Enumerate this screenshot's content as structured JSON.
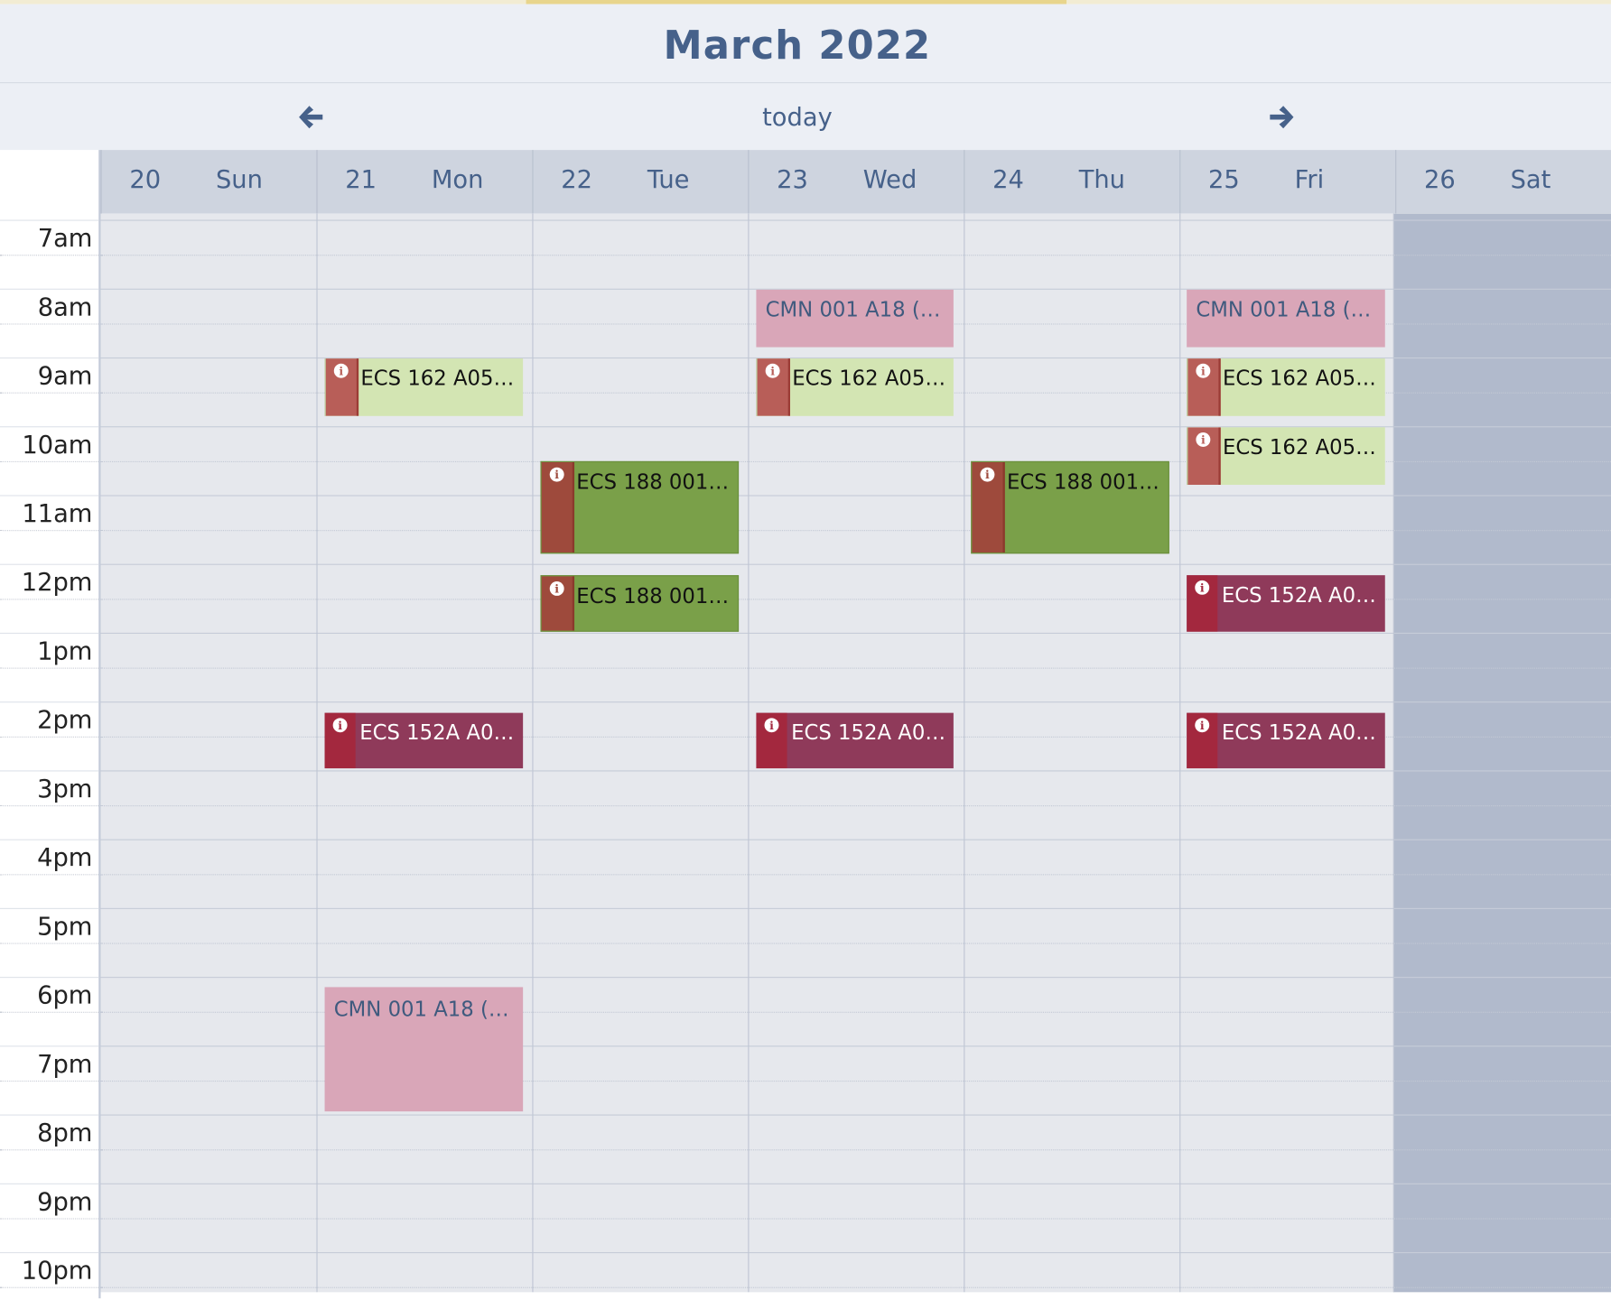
{
  "calendar": {
    "month_title": "March 2022",
    "today_label": "today",
    "prev_icon": "arrow-left-icon",
    "next_icon": "arrow-right-icon",
    "days": [
      {
        "num": "20",
        "name": "Sun"
      },
      {
        "num": "21",
        "name": "Mon"
      },
      {
        "num": "22",
        "name": "Tue"
      },
      {
        "num": "23",
        "name": "Wed"
      },
      {
        "num": "24",
        "name": "Thu"
      },
      {
        "num": "25",
        "name": "Fri"
      },
      {
        "num": "26",
        "name": "Sat"
      }
    ],
    "times": [
      "7am",
      "8am",
      "9am",
      "10am",
      "11am",
      "12pm",
      "1pm",
      "2pm",
      "3pm",
      "4pm",
      "5pm",
      "6pm",
      "7pm",
      "8pm",
      "9pm",
      "10pm"
    ],
    "events": [
      {
        "title": "CMN 001 A18 (D...",
        "color": "#d9a6b8"
      },
      {
        "title": "CMN 001 A18 (D...",
        "color": "#d9a6b8"
      },
      {
        "title": "ECS 162 A05 (...",
        "color": "#d3e5b3"
      },
      {
        "title": "ECS 162 A05 (...",
        "color": "#d3e5b3"
      },
      {
        "title": "ECS 162 A05 (...",
        "color": "#d3e5b3"
      },
      {
        "title": "ECS 162 A05 (...",
        "color": "#d3e5b3"
      },
      {
        "title": "ECS 188 001 (...",
        "color": "#7aa049"
      },
      {
        "title": "ECS 188 001 (...",
        "color": "#7aa049"
      },
      {
        "title": "ECS 188 001 (...",
        "color": "#7aa049"
      },
      {
        "title": "ECS 152A A03...",
        "color": "#8f3a5a"
      },
      {
        "title": "ECS 152A A03...",
        "color": "#8f3a5a"
      },
      {
        "title": "ECS 152A A03...",
        "color": "#8f3a5a"
      },
      {
        "title": "ECS 152A A03...",
        "color": "#8f3a5a"
      },
      {
        "title": "CMN 001 A18 (L...",
        "color": "#d9a6b8"
      }
    ],
    "info_glyph": "i"
  }
}
